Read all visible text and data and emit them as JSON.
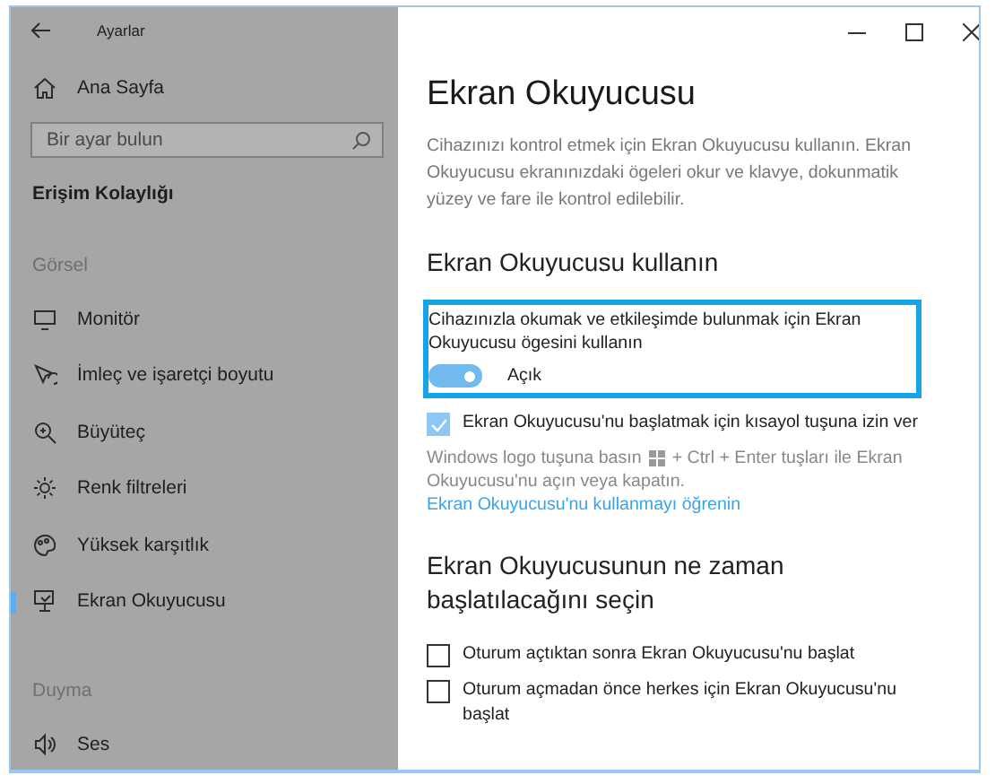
{
  "window": {
    "title": "Ayarlar"
  },
  "sidebar": {
    "home": {
      "label": "Ana Sayfa"
    },
    "search": {
      "placeholder": "Bir ayar bulun"
    },
    "category": "Erişim Kolaylığı",
    "groups": [
      {
        "heading": "Görsel",
        "items": [
          {
            "label": "Monitör",
            "kind": "monitor",
            "selected": false
          },
          {
            "label": "İmleç ve işaretçi boyutu",
            "kind": "cursor",
            "selected": false
          },
          {
            "label": "Büyüteç",
            "kind": "magnifier",
            "selected": false
          },
          {
            "label": "Renk filtreleri",
            "kind": "sun",
            "selected": false
          },
          {
            "label": "Yüksek karşıtlık",
            "kind": "palette",
            "selected": false
          },
          {
            "label": "Ekran Okuyucusu",
            "kind": "screen",
            "selected": true
          }
        ]
      },
      {
        "heading": "Duyma",
        "items": [
          {
            "label": "Ses",
            "kind": "speaker",
            "selected": false
          }
        ]
      }
    ]
  },
  "main": {
    "title": "Ekran Okuyucusu",
    "description": "Cihazınızı kontrol etmek için Ekran Okuyucusu kullanın. Ekran Okuyucusu ekranınızdaki ögeleri okur ve klavye, dokunmatik yüzey ve fare ile kontrol edilebilir.",
    "sections": [
      {
        "heading": "Ekran Okuyucusu kullanın",
        "toggle": {
          "label": "Cihazınızla okumak ve etkileşimde bulunmak için Ekran Okuyucusu ögesini kullanın",
          "on": true,
          "state_text": "Açık",
          "focused": true
        },
        "checkboxes": [
          {
            "label": "Ekran Okuyucusu'nu başlatmak için kısayol tuşuna izin ver",
            "checked": true
          }
        ],
        "hint": {
          "before": "Windows logo tuşuna basın",
          "after": "+ Ctrl + Enter tuşları ile Ekran",
          "continuation": "Okuyucusu'nu açın veya kapatın.",
          "link": "Ekran Okuyucusu'nu kullanmayı öğrenin"
        }
      },
      {
        "heading": "Ekran Okuyucusunun ne zaman başlatılacağını seçin",
        "checkboxes": [
          {
            "label": "Oturum açtıktan sonra Ekran Okuyucusu'nu başlat",
            "checked": false
          },
          {
            "label": "Oturum açmadan önce herkes için Ekran Okuyucusu'nu başlat",
            "checked": false
          }
        ]
      }
    ]
  }
}
